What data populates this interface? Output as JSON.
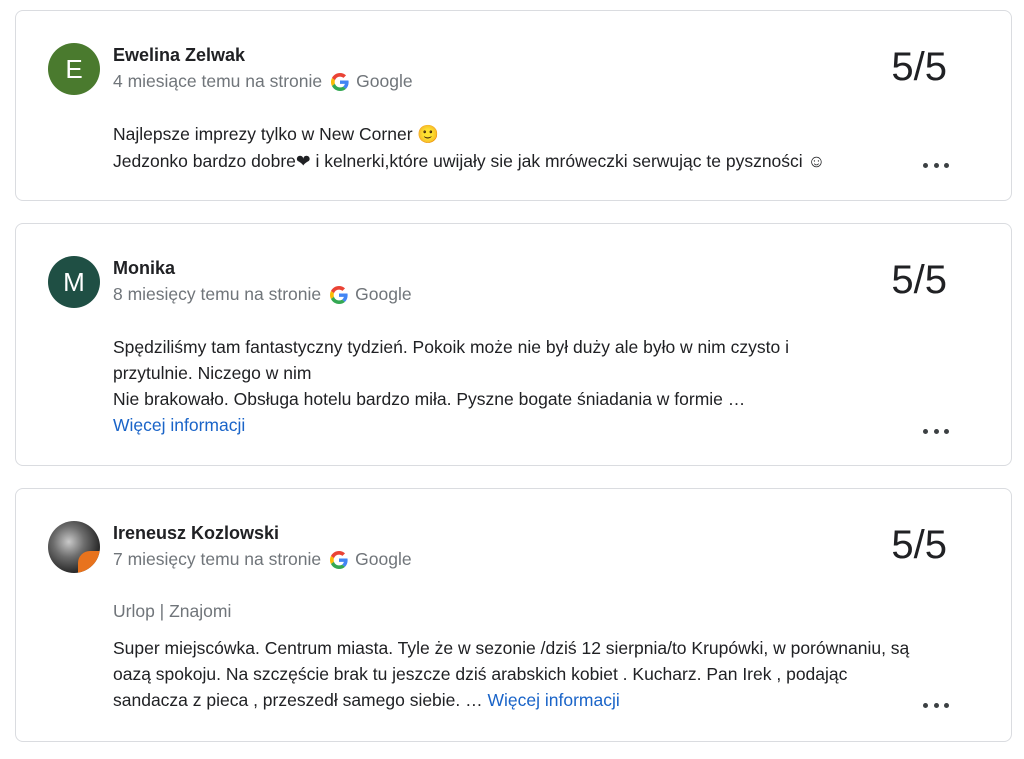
{
  "reviews": [
    {
      "avatar_letter": "E",
      "avatar_color": "#4a7a2e",
      "name": "Ewelina Zelwak",
      "time_source": "4 miesiące temu na stronie",
      "source_name": "Google",
      "source_icon": "google-g-icon",
      "score": "5/5",
      "text_line1": "Najlepsze imprezy tylko w New Corner",
      "text_line1_emoji": "🙂",
      "text_line2_a": "Jedzonko bardzo dobre",
      "text_line2_heart": "❤",
      "text_line2_b": " i kelnerki,które uwijały sie jak mróweczki serwując te pyszności ☺"
    },
    {
      "avatar_letter": "M",
      "avatar_color": "#1f4f44",
      "name": "Monika",
      "time_source": "8 miesięcy temu na stronie",
      "source_name": "Google",
      "source_icon": "google-g-icon",
      "score": "5/5",
      "text_line1": "Spędziliśmy tam fantastyczny tydzień. Pokoik może nie był duży ale było w nim czysto i",
      "text_line2": "przytulnie. Niczego w nim",
      "text_line3": "Nie brakowało. Obsługa hotelu bardzo miła. Pyszne bogate śniadania w formie …",
      "more_label": "Więcej informacji"
    },
    {
      "avatar_kind": "photo",
      "name": "Ireneusz Kozlowski",
      "time_source": "7 miesięcy temu na stronie",
      "source_name": "Google",
      "source_icon": "google-g-icon",
      "score": "5/5",
      "tags": "Urlop | Znajomi",
      "text": "Super miejscówka. Centrum miasta. Tyle że w sezonie /dziś 12 sierpnia/to Krupówki, w porównaniu, są oazą spokoju. Na szczęście brak tu jeszcze dziś arabskich kobiet . Kucharz. Pan Irek , podając sandacza z pieca , przeszedł samego siebie. …",
      "more_label": "Więcej informacji"
    }
  ],
  "colors": {
    "link": "#1a64c8",
    "muted": "#70757a",
    "border": "#dadce0"
  }
}
